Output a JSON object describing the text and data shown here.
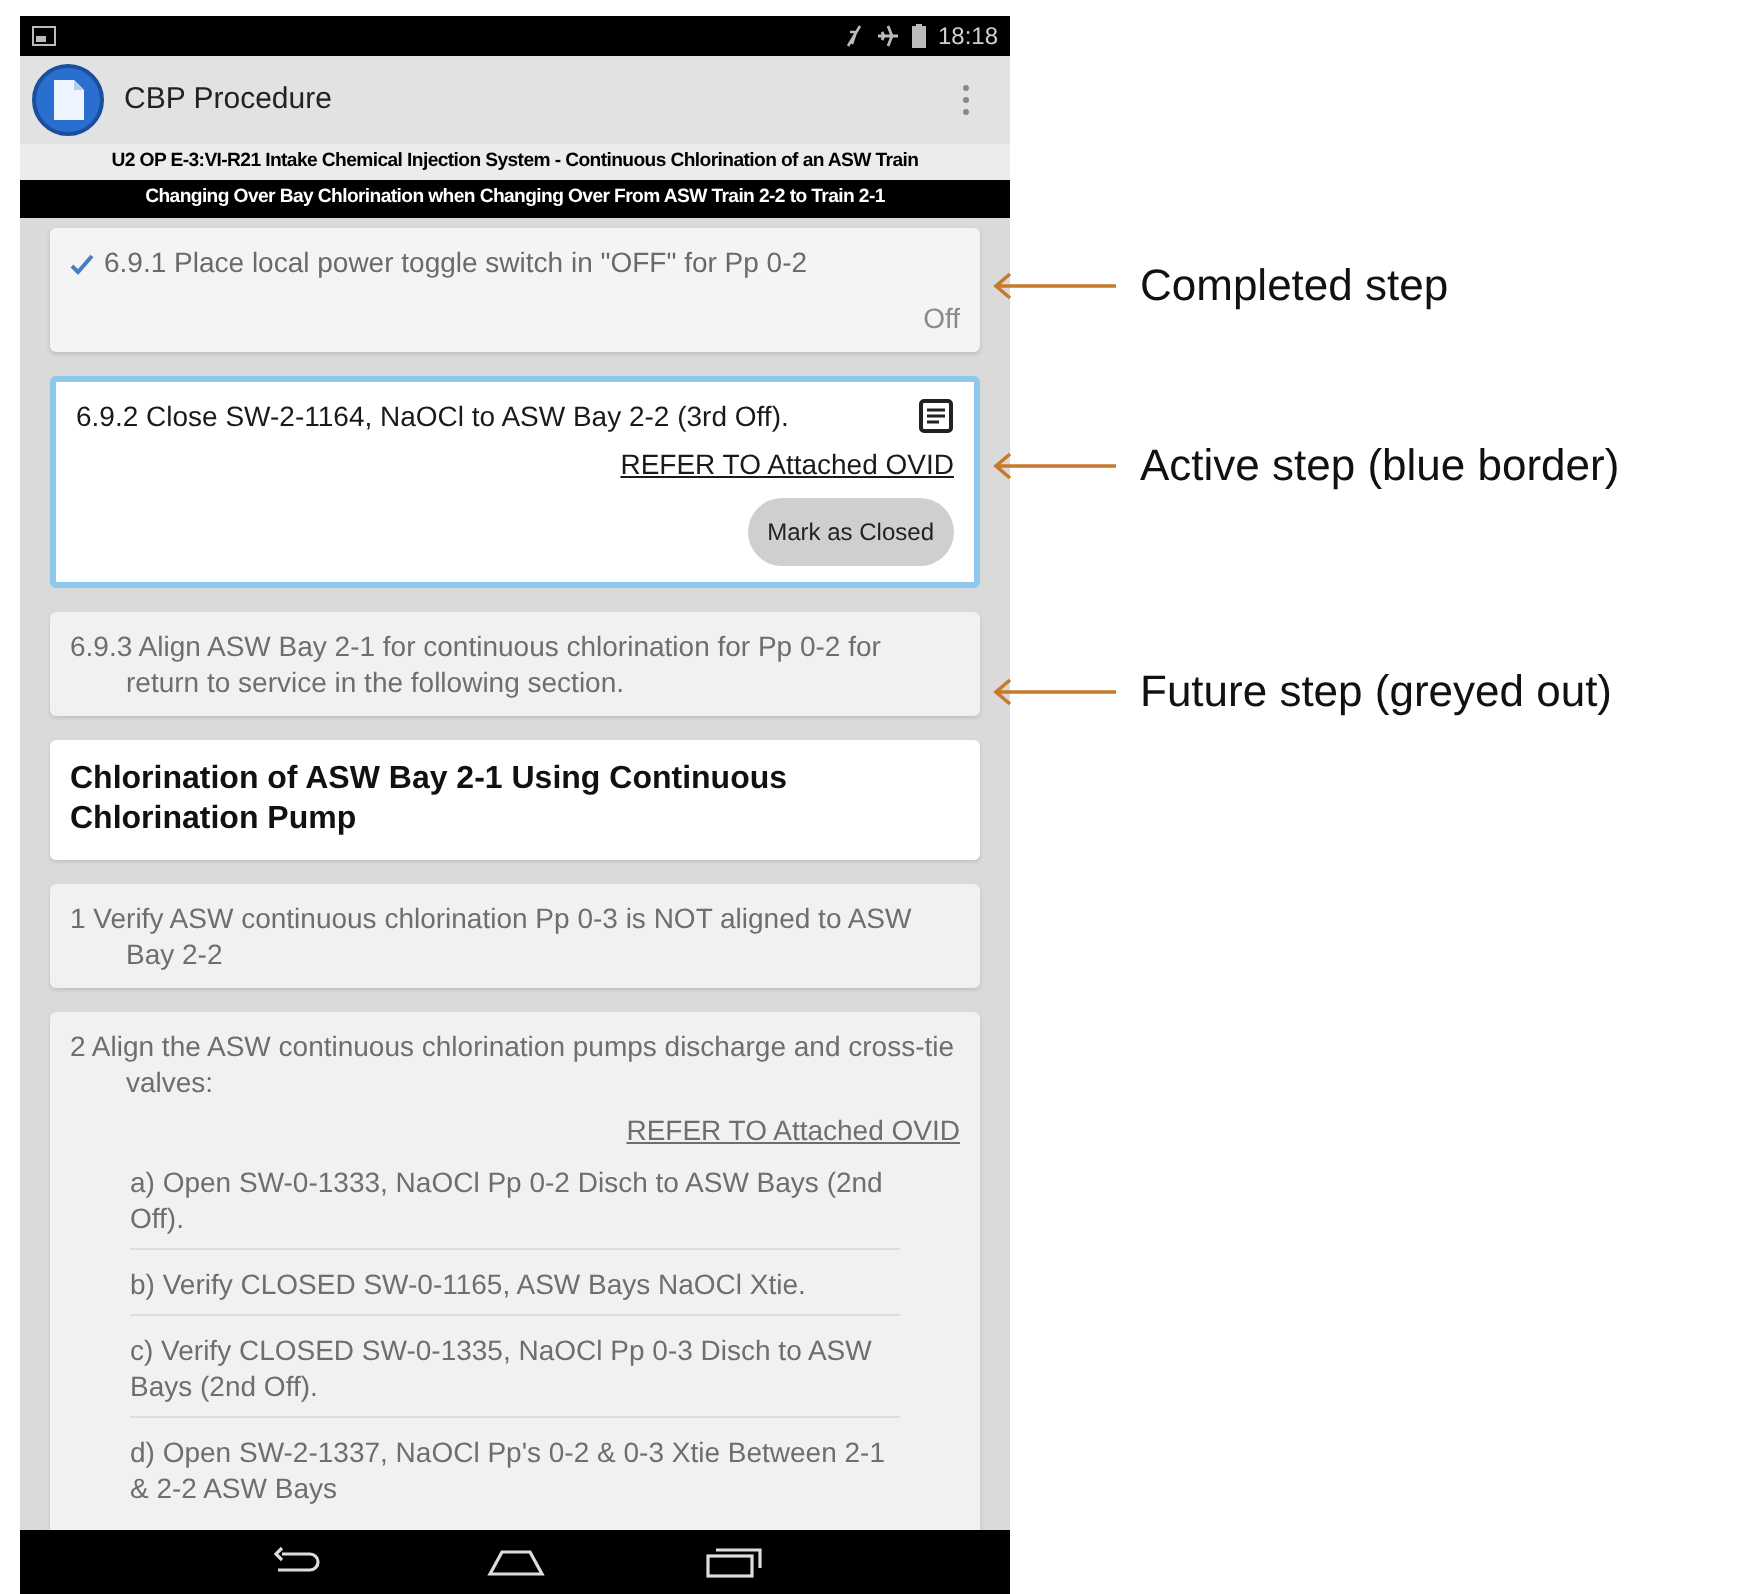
{
  "status_bar": {
    "time": "18:18"
  },
  "app_bar": {
    "title": "CBP Procedure"
  },
  "procedure_header": {
    "title": "U2 OP E-3:VI-R21 Intake Chemical Injection System - Continuous Chlorination of an ASW Train",
    "subtitle": "Changing Over Bay Chlorination when Changing Over From ASW Train 2-2 to Train 2-1"
  },
  "steps": [
    {
      "kind": "completed",
      "text": "6.9.1 Place local power toggle switch in \"OFF\" for Pp 0-2",
      "value": "Off"
    },
    {
      "kind": "active",
      "text": "6.9.2 Close SW-2-1164, NaOCl to ASW Bay 2-2 (3rd Off).",
      "link": "REFER TO Attached OVID",
      "button": "Mark as Closed"
    },
    {
      "kind": "future",
      "text": "6.9.3 Align ASW Bay 2-1 for continuous chlorination for Pp 0-2 for return to service in the following section."
    },
    {
      "kind": "section",
      "text": "Chlorination of ASW Bay 2-1 Using Continuous Chlorination Pump"
    },
    {
      "kind": "future",
      "text": "1 Verify ASW continuous chlorination Pp 0-3 is NOT aligned to ASW Bay 2-2"
    },
    {
      "kind": "future",
      "text": "2 Align the ASW continuous chlorination pumps discharge and cross-tie valves:",
      "link": "REFER TO Attached OVID",
      "substeps": [
        "a) Open SW-0-1333, NaOCl Pp 0-2 Disch to ASW Bays (2nd Off).",
        "b) Verify CLOSED SW-0-1165, ASW Bays NaOCl Xtie.",
        "c) Verify CLOSED SW-0-1335, NaOCl Pp 0-3 Disch to ASW Bays (2nd Off).",
        "d) Open SW-2-1337, NaOCl Pp's 0-2 & 0-3 Xtie Between 2-1 & 2-2 ASW Bays"
      ]
    }
  ],
  "callouts": [
    {
      "label": "Completed step"
    },
    {
      "label": "Active step (blue border)"
    },
    {
      "label": "Future step (greyed out)"
    }
  ]
}
